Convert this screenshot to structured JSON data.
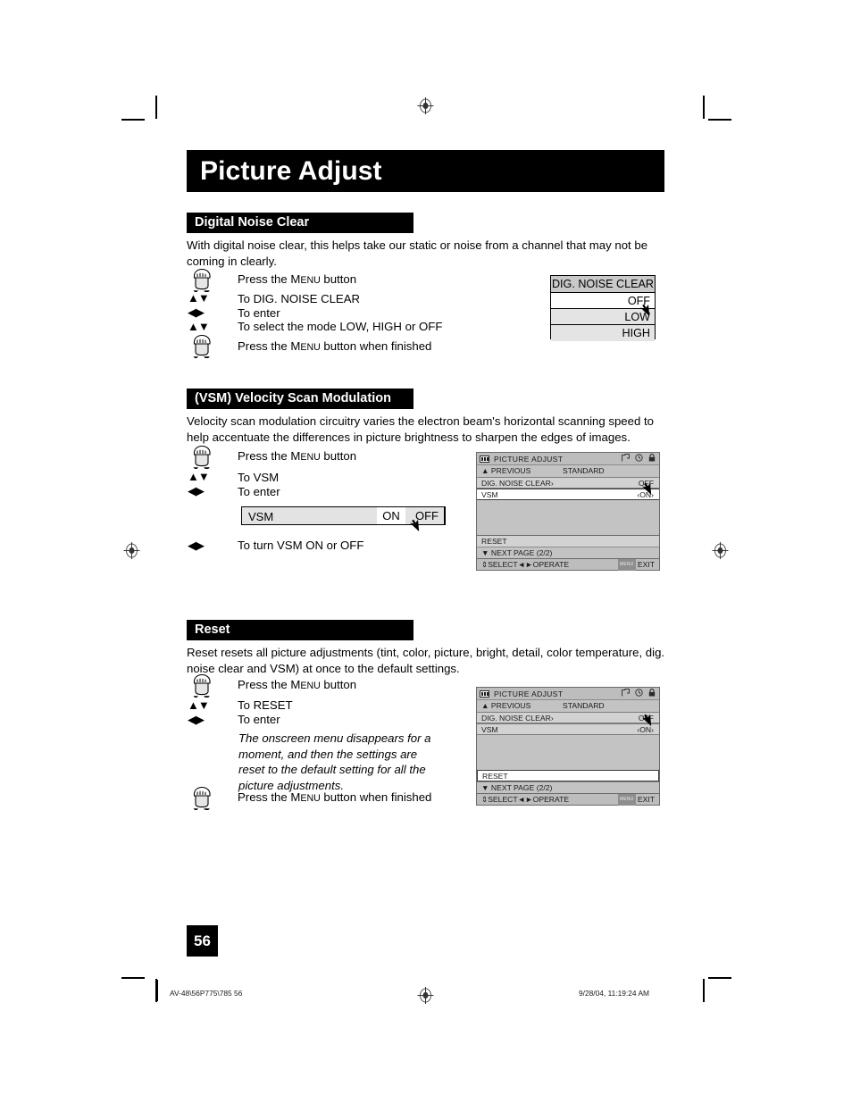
{
  "page": {
    "title": "Picture Adjust",
    "number": "56"
  },
  "sections": [
    {
      "id": "digital-noise-clear",
      "heading": "Digital Noise Clear",
      "body": "With digital noise clear, this helps take our static or noise from a channel that may not be coming in clearly.",
      "steps": [
        {
          "icon": "hand-press-icon",
          "text_lead": "Press the ",
          "text_sc": "Menu",
          "text_tail": " button"
        },
        {
          "icon": "up-down-arrows-icon",
          "text": "To DIG. NOISE CLEAR"
        },
        {
          "icon": "left-right-arrows-icon",
          "text": "To enter"
        },
        {
          "icon": "up-down-arrows-icon",
          "text": "To select the mode  LOW, HIGH or OFF"
        },
        {
          "icon": "hand-press-icon",
          "text_lead": "Press the ",
          "text_sc": "Menu",
          "text_tail": " button when finished"
        }
      ]
    },
    {
      "id": "vsm",
      "heading": "(VSM) Velocity Scan Modulation",
      "body": "Velocity scan modulation circuitry varies the electron beam's horizontal scanning speed to help accentuate the differences in picture brightness to sharpen the edges of images.",
      "steps": [
        {
          "icon": "hand-press-icon",
          "text_lead": "Press the ",
          "text_sc": "Menu",
          "text_tail": " button"
        },
        {
          "icon": "up-down-arrows-icon",
          "text": "To VSM"
        },
        {
          "icon": "left-right-arrows-icon",
          "text": "To enter"
        },
        {
          "icon": "left-right-arrows-icon",
          "text": "To turn VSM ON or OFF"
        }
      ]
    },
    {
      "id": "reset",
      "heading": "Reset",
      "body": "Reset resets all picture adjustments (tint, color, picture, bright, detail, color temperature, dig. noise clear and VSM) at once to the default settings.",
      "note": "The onscreen menu disappears for a moment, and then the settings are reset to the default setting for all the picture adjustments.",
      "steps": [
        {
          "icon": "hand-press-icon",
          "text_lead": "Press the ",
          "text_sc": "Menu",
          "text_tail": " button"
        },
        {
          "icon": "up-down-arrows-icon",
          "text": "To RESET"
        },
        {
          "icon": "left-right-arrows-icon",
          "text": "To enter"
        },
        {
          "icon": "hand-press-icon",
          "text_lead": "Press the ",
          "text_sc": "Menu",
          "text_tail": " button when finished"
        }
      ]
    }
  ],
  "dnc_popup": {
    "header": "DIG. NOISE CLEAR",
    "options": [
      {
        "label": "OFF",
        "selected": true
      },
      {
        "label": "LOW",
        "selected": false
      },
      {
        "label": "HIGH",
        "selected": false
      }
    ]
  },
  "vsm_strip": {
    "label": "VSM",
    "on_label": "ON",
    "off_label": "OFF",
    "selected": "ON"
  },
  "osd_vsm": {
    "title": "PICTURE ADJUST",
    "title_icons": [
      "page-icon",
      "clock-icon",
      "lock-icon"
    ],
    "previous_label": "PREVIOUS",
    "preset_label": "STANDARD",
    "rows": [
      {
        "label": "DIG. NOISE CLEAR›",
        "value": "OFF",
        "highlighted": false
      },
      {
        "label": "VSM",
        "value": "‹ON›",
        "highlighted": true
      }
    ],
    "reset_label": "RESET",
    "reset_highlighted": false,
    "next_page_label": "NEXT PAGE",
    "page_indicator": "(2/2)",
    "footer_select": "SELECT",
    "footer_operate": "OPERATE",
    "footer_menu_badge": "MENU",
    "footer_exit": "EXIT"
  },
  "osd_reset": {
    "title": "PICTURE ADJUST",
    "title_icons": [
      "page-icon",
      "clock-icon",
      "lock-icon"
    ],
    "previous_label": "PREVIOUS",
    "preset_label": "STANDARD",
    "rows": [
      {
        "label": "DIG. NOISE CLEAR›",
        "value": "OFF",
        "highlighted": false
      },
      {
        "label": "VSM",
        "value": "‹ON›",
        "highlighted": false
      }
    ],
    "reset_label": "RESET",
    "reset_highlighted": true,
    "next_page_label": "NEXT PAGE",
    "page_indicator": "(2/2)",
    "footer_select": "SELECT",
    "footer_operate": "OPERATE",
    "footer_menu_badge": "MENU",
    "footer_exit": "EXIT"
  },
  "print_footer": {
    "job": "AV-48\\56P775\\785   56",
    "timestamp": "9/28/04, 11:19:24 AM"
  }
}
